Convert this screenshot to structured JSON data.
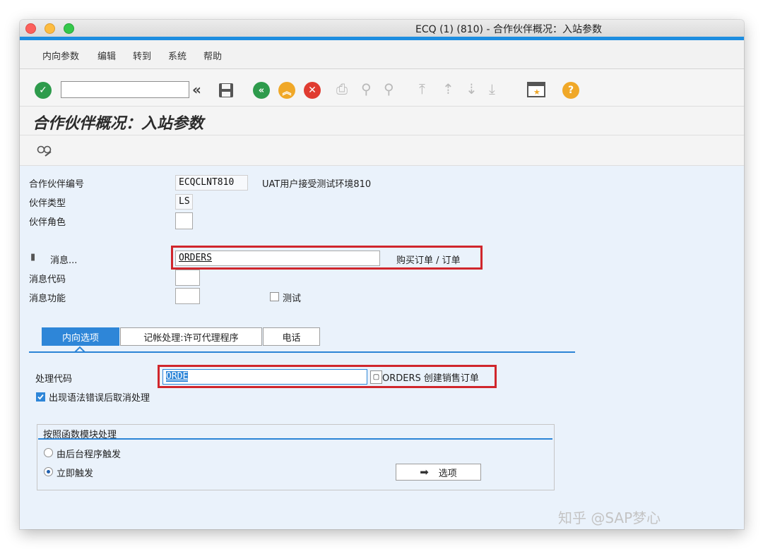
{
  "window": {
    "title": "ECQ (1) (810) - 合作伙伴概况：入站参数"
  },
  "menu": [
    "内向参数",
    "编辑",
    "转到",
    "系统",
    "帮助"
  ],
  "toolbar": {
    "command_value": "",
    "icons": [
      "enter-icon",
      "collapse-icon",
      "save-icon",
      "back-icon",
      "exit-icon",
      "cancel-icon",
      "print-icon",
      "find-icon",
      "find-next-icon",
      "first-page-icon",
      "prev-page-icon",
      "next-page-icon",
      "last-page-icon",
      "create-session-icon",
      "help-icon"
    ],
    "colors": {
      "enter": "#2e9b4c",
      "back": "#2e9b4c",
      "exit": "#f0a828",
      "cancel": "#e03c31",
      "help": "#f0a828"
    }
  },
  "page": {
    "heading": "合作伙伴概况：入站参数",
    "subbar_icon": "display-change-icon"
  },
  "fields": {
    "partner_no": {
      "label": "合作伙伴编号",
      "value": "ECQCLNT810",
      "desc": "UAT用户接受测试环境810"
    },
    "partner_type": {
      "label": "伙伴类型",
      "value": "LS"
    },
    "partner_role": {
      "label": "伙伴角色",
      "value": ""
    },
    "message": {
      "label": "消息...",
      "value": "ORDERS",
      "desc": "购买订单 / 订单"
    },
    "message_code": {
      "label": "消息代码",
      "value": ""
    },
    "message_function": {
      "label": "消息功能",
      "value": ""
    },
    "test": {
      "label": "测试",
      "checked": false
    }
  },
  "tabs": [
    {
      "label": "内向选项",
      "active": true
    },
    {
      "label": "记帐处理:许可代理程序",
      "active": false
    },
    {
      "label": "电话",
      "active": false
    }
  ],
  "inbound": {
    "process_code": {
      "label": "处理代码",
      "value": "ORDE",
      "desc": "ORDERS 创建销售订单"
    },
    "cancel_on_syntax_error": {
      "label": "出现语法错误后取消处理",
      "checked": true
    },
    "group": {
      "title": "按照函数模块处理",
      "options": [
        {
          "label": "由后台程序触发",
          "selected": false
        },
        {
          "label": "立即触发",
          "selected": true
        }
      ],
      "options_button": "选项"
    }
  },
  "accent": {
    "blue": "#1d8de0",
    "highlight_red": "#d0262c"
  },
  "watermark": "知乎 @SAP梦心"
}
